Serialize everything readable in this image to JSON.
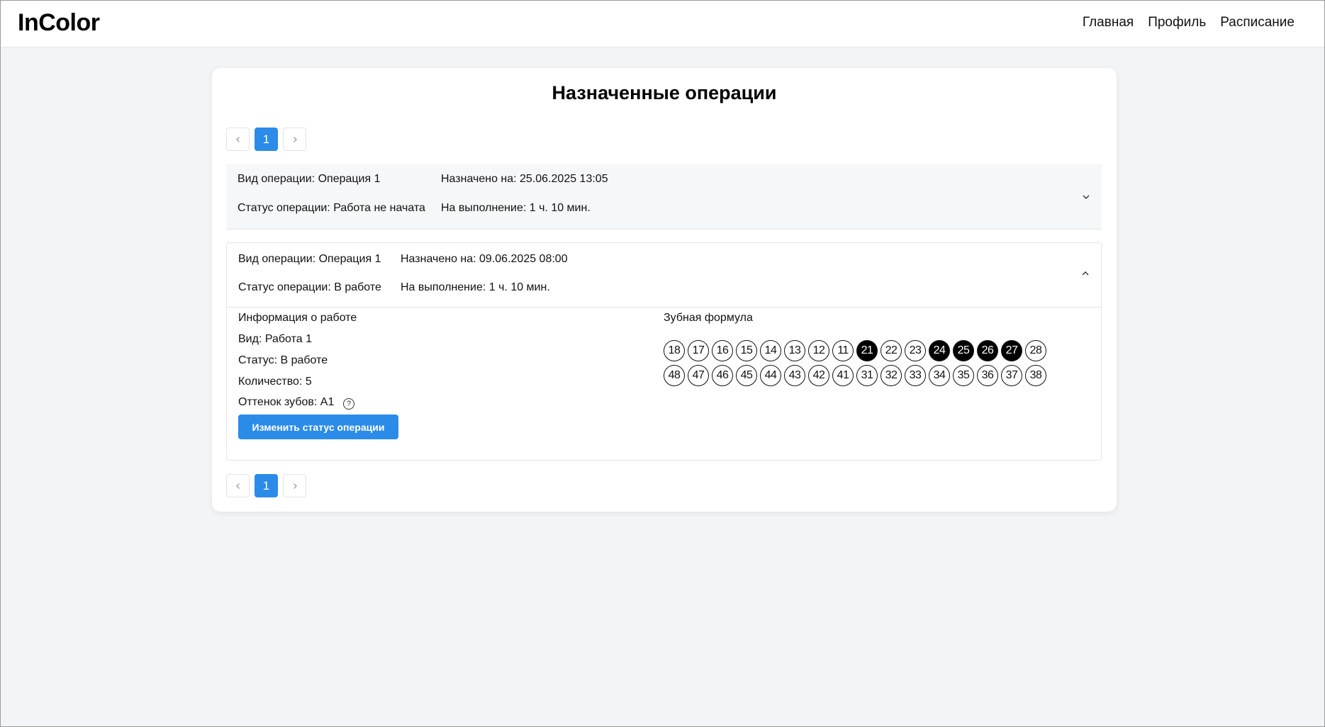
{
  "app": {
    "title": "InColor"
  },
  "nav": {
    "items": [
      "Главная",
      "Профиль",
      "Расписание"
    ]
  },
  "page": {
    "title": "Назначенные операции"
  },
  "pagination": {
    "current": "1"
  },
  "operations": [
    {
      "type_label": "Вид операции: Операция 1",
      "assigned_label": "Назначено на: 25.06.2025 13:05",
      "status_label": "Статус операции: Работа не начата",
      "duration_label": "На выполнение: 1 ч. 10 мин.",
      "expanded": false
    },
    {
      "type_label": "Вид операции: Операция 1",
      "assigned_label": "Назначено на: 09.06.2025 08:00",
      "status_label": "Статус операции: В работе",
      "duration_label": "На выполнение: 1 ч. 10 мин.",
      "expanded": true,
      "details": {
        "work_info_title": "Информация о работе",
        "kind": "Вид: Работа 1",
        "status": "Статус: В работе",
        "quantity": "Количество: 5",
        "shade": "Оттенок зубов: A1",
        "change_status_button": "Изменить статус операции",
        "formula_title": "Зубная формула"
      }
    }
  ],
  "teeth": {
    "upper": [
      "18",
      "17",
      "16",
      "15",
      "14",
      "13",
      "12",
      "11",
      "21",
      "22",
      "23",
      "24",
      "25",
      "26",
      "27",
      "28"
    ],
    "lower": [
      "48",
      "47",
      "46",
      "45",
      "44",
      "43",
      "42",
      "41",
      "31",
      "32",
      "33",
      "34",
      "35",
      "36",
      "37",
      "38"
    ],
    "selected": [
      "21",
      "24",
      "25",
      "26",
      "27"
    ]
  },
  "colors": {
    "accent": "#2b8be8",
    "selected_tooth": "#000000"
  },
  "icons": {
    "help": "question-circle-icon",
    "expand": "chevron-down-icon",
    "collapse": "chevron-up-icon"
  }
}
